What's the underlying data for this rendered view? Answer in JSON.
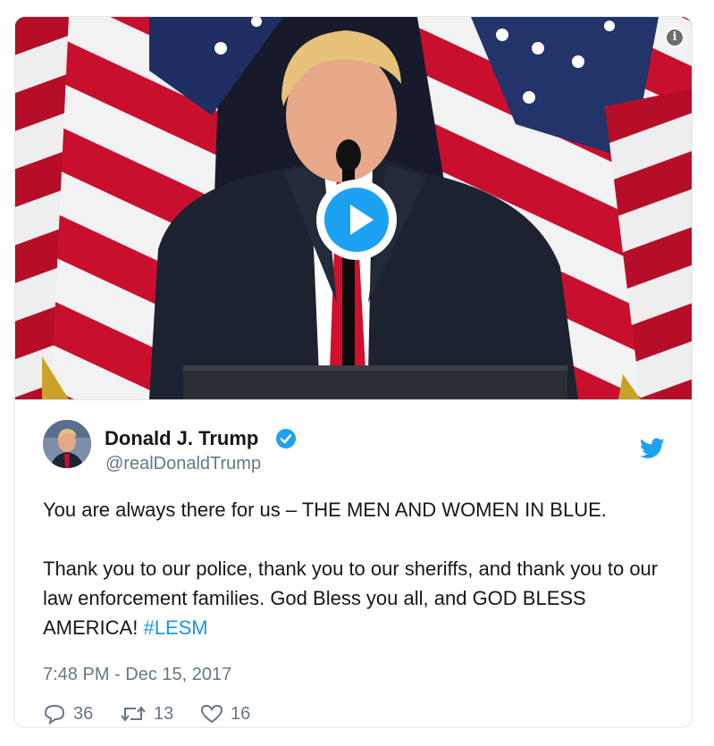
{
  "media": {
    "info_glyph": "i",
    "play_icon": "play-icon",
    "info_icon": "info-icon"
  },
  "author": {
    "name": "Donald J. Trump",
    "handle": "@realDonaldTrump",
    "verified": true
  },
  "tweet": {
    "paragraph1": "You are always there for us – THE MEN AND WOMEN IN BLUE.",
    "paragraph2_text": "Thank you to our police, thank you to our sheriffs, and thank you to our law enforcement families. God Bless you all, and GOD BLESS AMERICA! ",
    "hashtag": "#LESM",
    "timestamp": "7:48 PM - Dec 15, 2017"
  },
  "actions": {
    "replies": "36",
    "retweets": "13",
    "likes": "16"
  },
  "colors": {
    "accent": "#1da1f2",
    "hashtag": "#1b95e0",
    "muted": "#657786",
    "text": "#14171a"
  }
}
